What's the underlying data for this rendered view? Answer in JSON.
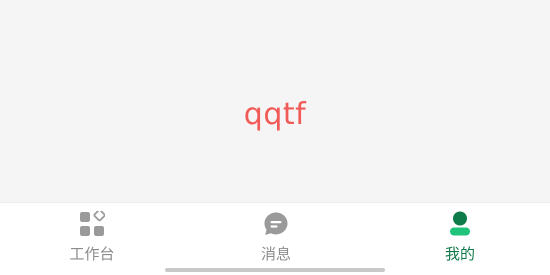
{
  "main": {
    "center_text": "qqtf",
    "center_text_color": "#f15b57",
    "background": "#f5f5f5"
  },
  "tabbar": {
    "inactive_color": "#9a9a9a",
    "inactive_label_color": "#8c8c8c",
    "active_color": "#0f7a4a",
    "tabs": [
      {
        "label": "工作台",
        "icon": "grid-icon",
        "active": false
      },
      {
        "label": "消息",
        "icon": "chat-bubble-icon",
        "active": false
      },
      {
        "label": "我的",
        "icon": "user-icon",
        "active": true
      }
    ]
  }
}
